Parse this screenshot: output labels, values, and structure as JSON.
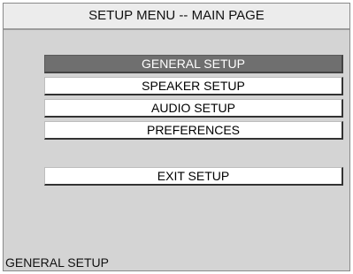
{
  "window": {
    "title": "SETUP MENU -- MAIN PAGE"
  },
  "menu": {
    "items": [
      {
        "label": "GENERAL SETUP",
        "selected": true
      },
      {
        "label": "SPEAKER SETUP",
        "selected": false
      },
      {
        "label": "AUDIO SETUP",
        "selected": false
      },
      {
        "label": "PREFERENCES",
        "selected": false
      }
    ],
    "exit_label": "EXIT SETUP"
  },
  "status": {
    "text": "GENERAL SETUP"
  },
  "colors": {
    "panel_background": "#d4d4d4",
    "title_background": "#ececec",
    "selected_background": "#6f6f6f",
    "item_background": "#ffffff"
  }
}
